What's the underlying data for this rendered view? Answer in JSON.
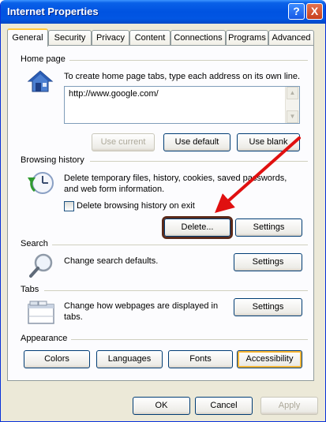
{
  "window": {
    "title": "Internet Properties"
  },
  "titlebar": {
    "help_label": "?",
    "close_label": "X"
  },
  "tabs": [
    {
      "label": "General"
    },
    {
      "label": "Security"
    },
    {
      "label": "Privacy"
    },
    {
      "label": "Content"
    },
    {
      "label": "Connections"
    },
    {
      "label": "Programs"
    },
    {
      "label": "Advanced"
    }
  ],
  "home_page": {
    "title": "Home page",
    "description": "To create home page tabs, type each address on its own line.",
    "value": "http://www.google.com/",
    "use_current": "Use current",
    "use_default": "Use default",
    "use_blank": "Use blank"
  },
  "browsing_history": {
    "title": "Browsing history",
    "description_line1": "Delete temporary files, history, cookies, saved passwords,",
    "description_line2": "and web form information.",
    "checkbox_label": "Delete browsing history on exit",
    "delete_button": "Delete...",
    "settings_button": "Settings"
  },
  "search": {
    "title": "Search",
    "description": "Change search defaults.",
    "settings_button": "Settings"
  },
  "tabs_group": {
    "title": "Tabs",
    "description_line1": "Change how webpages are displayed in",
    "description_line2": "tabs.",
    "settings_button": "Settings"
  },
  "appearance": {
    "title": "Appearance",
    "colors": "Colors",
    "languages": "Languages",
    "fonts": "Fonts",
    "accessibility": "Accessibility"
  },
  "dialog": {
    "ok": "OK",
    "cancel": "Cancel",
    "apply": "Apply"
  },
  "annotation": {
    "color": "#e01010"
  }
}
